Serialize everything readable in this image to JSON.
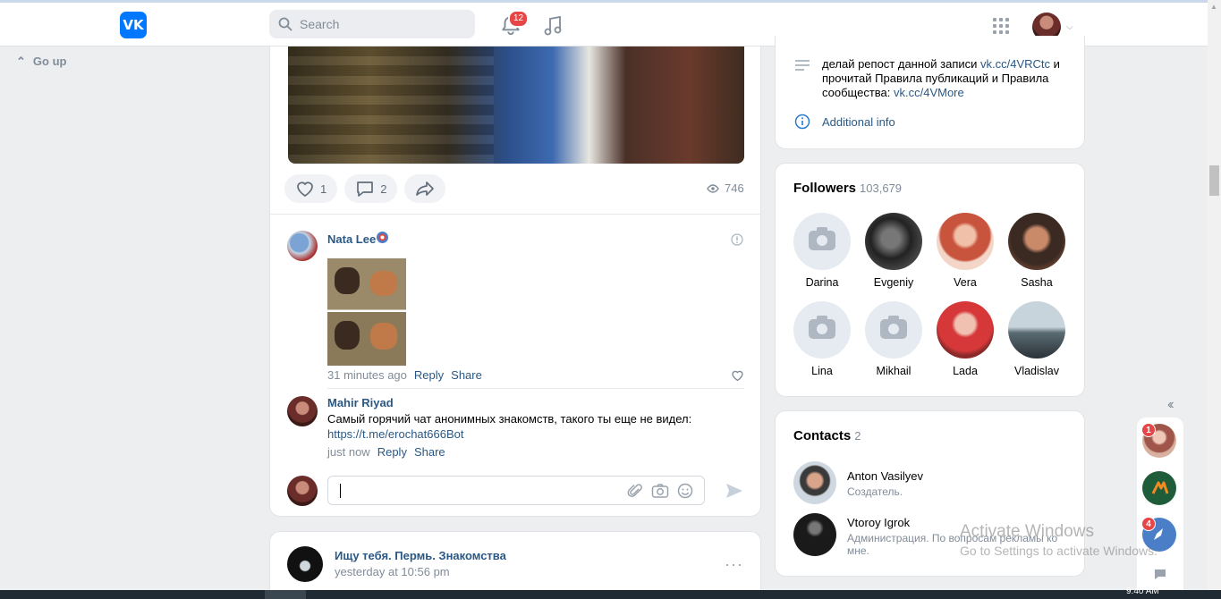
{
  "header": {
    "logo": "VK",
    "search_placeholder": "Search",
    "notifications_count": "12"
  },
  "left": {
    "go_up": "Go up"
  },
  "post": {
    "likes": "1",
    "comments": "2",
    "views": "746"
  },
  "comments": [
    {
      "author": "Nata Lee",
      "time": "31 minutes ago",
      "reply": "Reply",
      "share": "Share"
    },
    {
      "author": "Mahir Riyad",
      "text": "Самый горячий чат анонимных знакомств, такого ты еще не видел:",
      "link": "https://t.me/erochat666Bot",
      "time": "just now",
      "reply": "Reply",
      "share": "Share"
    }
  ],
  "next_post": {
    "group": "Ищу тебя. Пермь. Знакомства",
    "time": "yesterday at 10:56 pm"
  },
  "info": {
    "text_before": "делай репост данной записи ",
    "link1": "vk.cc/4VRCtc",
    "text_mid": " и прочитай Правила публикаций и Правила сообщества: ",
    "link2": "vk.cc/4VMore",
    "additional": "Additional info"
  },
  "followers": {
    "title": "Followers",
    "count": "103,679",
    "items": [
      {
        "name": "Darina"
      },
      {
        "name": "Evgeniy"
      },
      {
        "name": "Vera"
      },
      {
        "name": "Sasha"
      },
      {
        "name": "Lina"
      },
      {
        "name": "Mikhail"
      },
      {
        "name": "Lada"
      },
      {
        "name": "Vladislav"
      }
    ]
  },
  "contacts": {
    "title": "Contacts",
    "count": "2",
    "items": [
      {
        "name": "Anton Vasilyev",
        "role": "Создатель."
      },
      {
        "name": "Vtoroy Igrok",
        "role": "Администрация. По вопросам рекламы ко мне."
      }
    ]
  },
  "watermark": {
    "line1": "Activate Windows",
    "line2": "Go to Settings to activate Windows."
  },
  "float_panel": {
    "badge1": "1",
    "badge2": "4"
  },
  "taskbar": {
    "clock": "9:40 AM"
  },
  "colors": {
    "accent": "#0077ff",
    "link": "#2a5885",
    "badge": "#e64646"
  }
}
